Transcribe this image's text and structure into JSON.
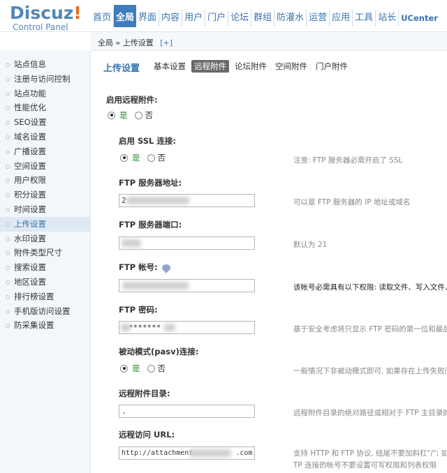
{
  "logo": {
    "brand": "Discuz",
    "brand_mark": "!",
    "sub": "Control Panel"
  },
  "topnav": [
    "首页",
    "全局",
    "界面",
    "内容",
    "用户",
    "门户",
    "论坛",
    "群组",
    "防灌水",
    "运营",
    "应用",
    "工具",
    "站长",
    "UCenter"
  ],
  "crumb": {
    "text": "全局 » 上传设置",
    "plus": "[+]"
  },
  "sidebar": [
    "站点信息",
    "注册与访问控制",
    "站点功能",
    "性能优化",
    "SEO设置",
    "域名设置",
    "广播设置",
    "空间设置",
    "用户权限",
    "积分设置",
    "时间设置",
    "上传设置",
    "水印设置",
    "附件类型尺寸",
    "搜索设置",
    "地区设置",
    "排行榜设置",
    "手机版访问设置",
    "防采集设置"
  ],
  "subnav": {
    "title": "上传设置",
    "tabs": [
      "基本设置",
      "远程附件",
      "论坛附件",
      "空间附件",
      "门户附件"
    ]
  },
  "form": {
    "enable_remote": {
      "label": "启用远程附件:",
      "yes": "是",
      "no": "否"
    },
    "ssl": {
      "label": "启用 SSL 连接:",
      "yes": "是",
      "no": "否",
      "tip": "注意: FTP 服务器必需开启了 SSL"
    },
    "ftp_host": {
      "label": "FTP 服务器地址:",
      "value": "2",
      "tip": "可以是 FTP 服务器的 IP 地址或域名"
    },
    "ftp_port": {
      "label": "FTP 服务器端口:",
      "value": "",
      "tip": "默认为 21"
    },
    "ftp_user": {
      "label": "FTP 帐号:",
      "value": "",
      "tip": "该帐号必需具有以下权限: 读取文件、写入文件、"
    },
    "ftp_pass": {
      "label": "FTP 密码:",
      "value": "*******",
      "tip": "基于安全考虑将只显示 FTP 密码的第一位和最后"
    },
    "pasv": {
      "label": "被动模式(pasv)连接:",
      "yes": "是",
      "no": "否",
      "tip": "一般情况下非被动模式即可, 如果存在上传失败问"
    },
    "remote_dir": {
      "label": "远程附件目录:",
      "value": ".",
      "tip": "远程附件目录的绝对路径或相对于 FTP 主目录的"
    },
    "remote_url": {
      "label": "远程访问 URL:",
      "value_prefix": "http://attachment.",
      "value_suffix": ".com",
      "tip": "支持 HTTP 和 FTP 协议, 结尾不要加斜杠\"/\"; 如",
      "tip2": "TP 连接的帐号不要设置可写权限和列表权限"
    }
  }
}
